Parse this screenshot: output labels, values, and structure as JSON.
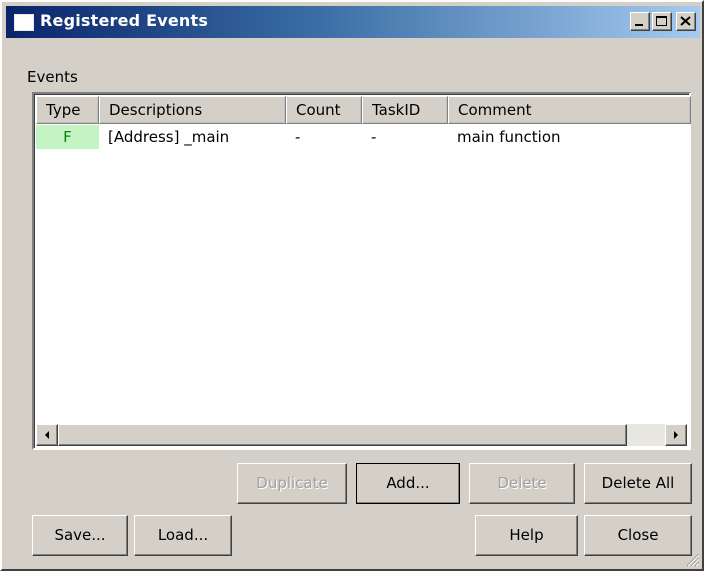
{
  "window": {
    "title": "Registered Events"
  },
  "events": {
    "label": "Events",
    "columns": [
      "Type",
      "Descriptions",
      "Count",
      "TaskID",
      "Comment"
    ],
    "rows": [
      {
        "type": "F",
        "description": "[Address] _main",
        "count": "-",
        "taskid": "-",
        "comment": "main function"
      }
    ]
  },
  "buttons": {
    "duplicate": "Duplicate",
    "add": "Add...",
    "delete": "Delete",
    "delete_all": "Delete All",
    "save": "Save...",
    "load": "Load...",
    "help": "Help",
    "close": "Close"
  },
  "colors": {
    "title_gradient_start": "#0a246a",
    "title_gradient_end": "#a6caf0",
    "type_cell_bg": "#c4f4c4",
    "window_bg": "#d4d0c8"
  },
  "icons": {
    "window": "window-icon",
    "minimize": "minimize-icon",
    "maximize": "maximize-icon",
    "close": "close-icon",
    "scroll_left": "arrow-left-icon",
    "scroll_right": "arrow-right-icon",
    "grip": "resize-grip-icon"
  }
}
